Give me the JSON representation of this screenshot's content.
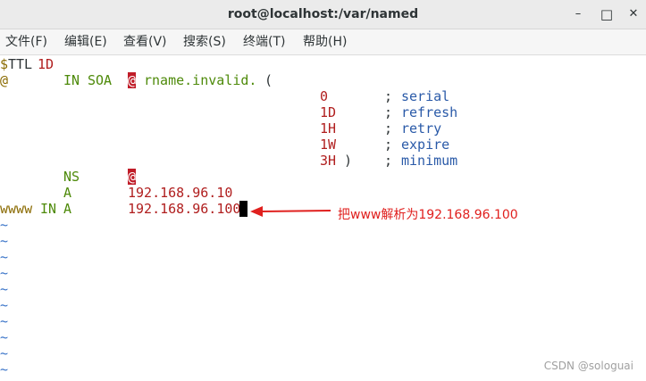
{
  "window": {
    "title": "root@localhost:/var/named",
    "minimize_glyph": "–",
    "maximize_glyph": "□",
    "close_glyph": "✕"
  },
  "menu": {
    "file": "文件(F)",
    "edit": "编辑(E)",
    "view": "查看(V)",
    "search": "搜索(S)",
    "terminal": "终端(T)",
    "help": "帮助(H)"
  },
  "zone": {
    "line1": {
      "dollar": "$",
      "ttl": "TTL",
      "ttl_value": "1D"
    },
    "line2": {
      "origin": "@",
      "class": "IN",
      "type": "SOA",
      "mname": "@",
      "rname": "rname.invalid.",
      "paren": "("
    },
    "serial": {
      "value": "0",
      "sep": ";",
      "label": "serial"
    },
    "refresh": {
      "value": "1D",
      "sep": ";",
      "label": "refresh"
    },
    "retry": {
      "value": "1H",
      "sep": ";",
      "label": "retry"
    },
    "expire": {
      "value": "1W",
      "sep": ";",
      "label": "expire"
    },
    "minimum": {
      "value": "3H",
      "close": ")",
      "sep": ";",
      "label": "minimum"
    },
    "ns": {
      "type": "NS",
      "target": "@"
    },
    "a1": {
      "type": "A",
      "address": "192.168.96.10"
    },
    "www": {
      "name": "wwww",
      "class": "IN",
      "type": "A",
      "address": "192.168.96.100"
    },
    "tilde": "~"
  },
  "annotation": {
    "text": "把www解析为192.168.96.100"
  },
  "watermark": "CSDN @sologuai"
}
